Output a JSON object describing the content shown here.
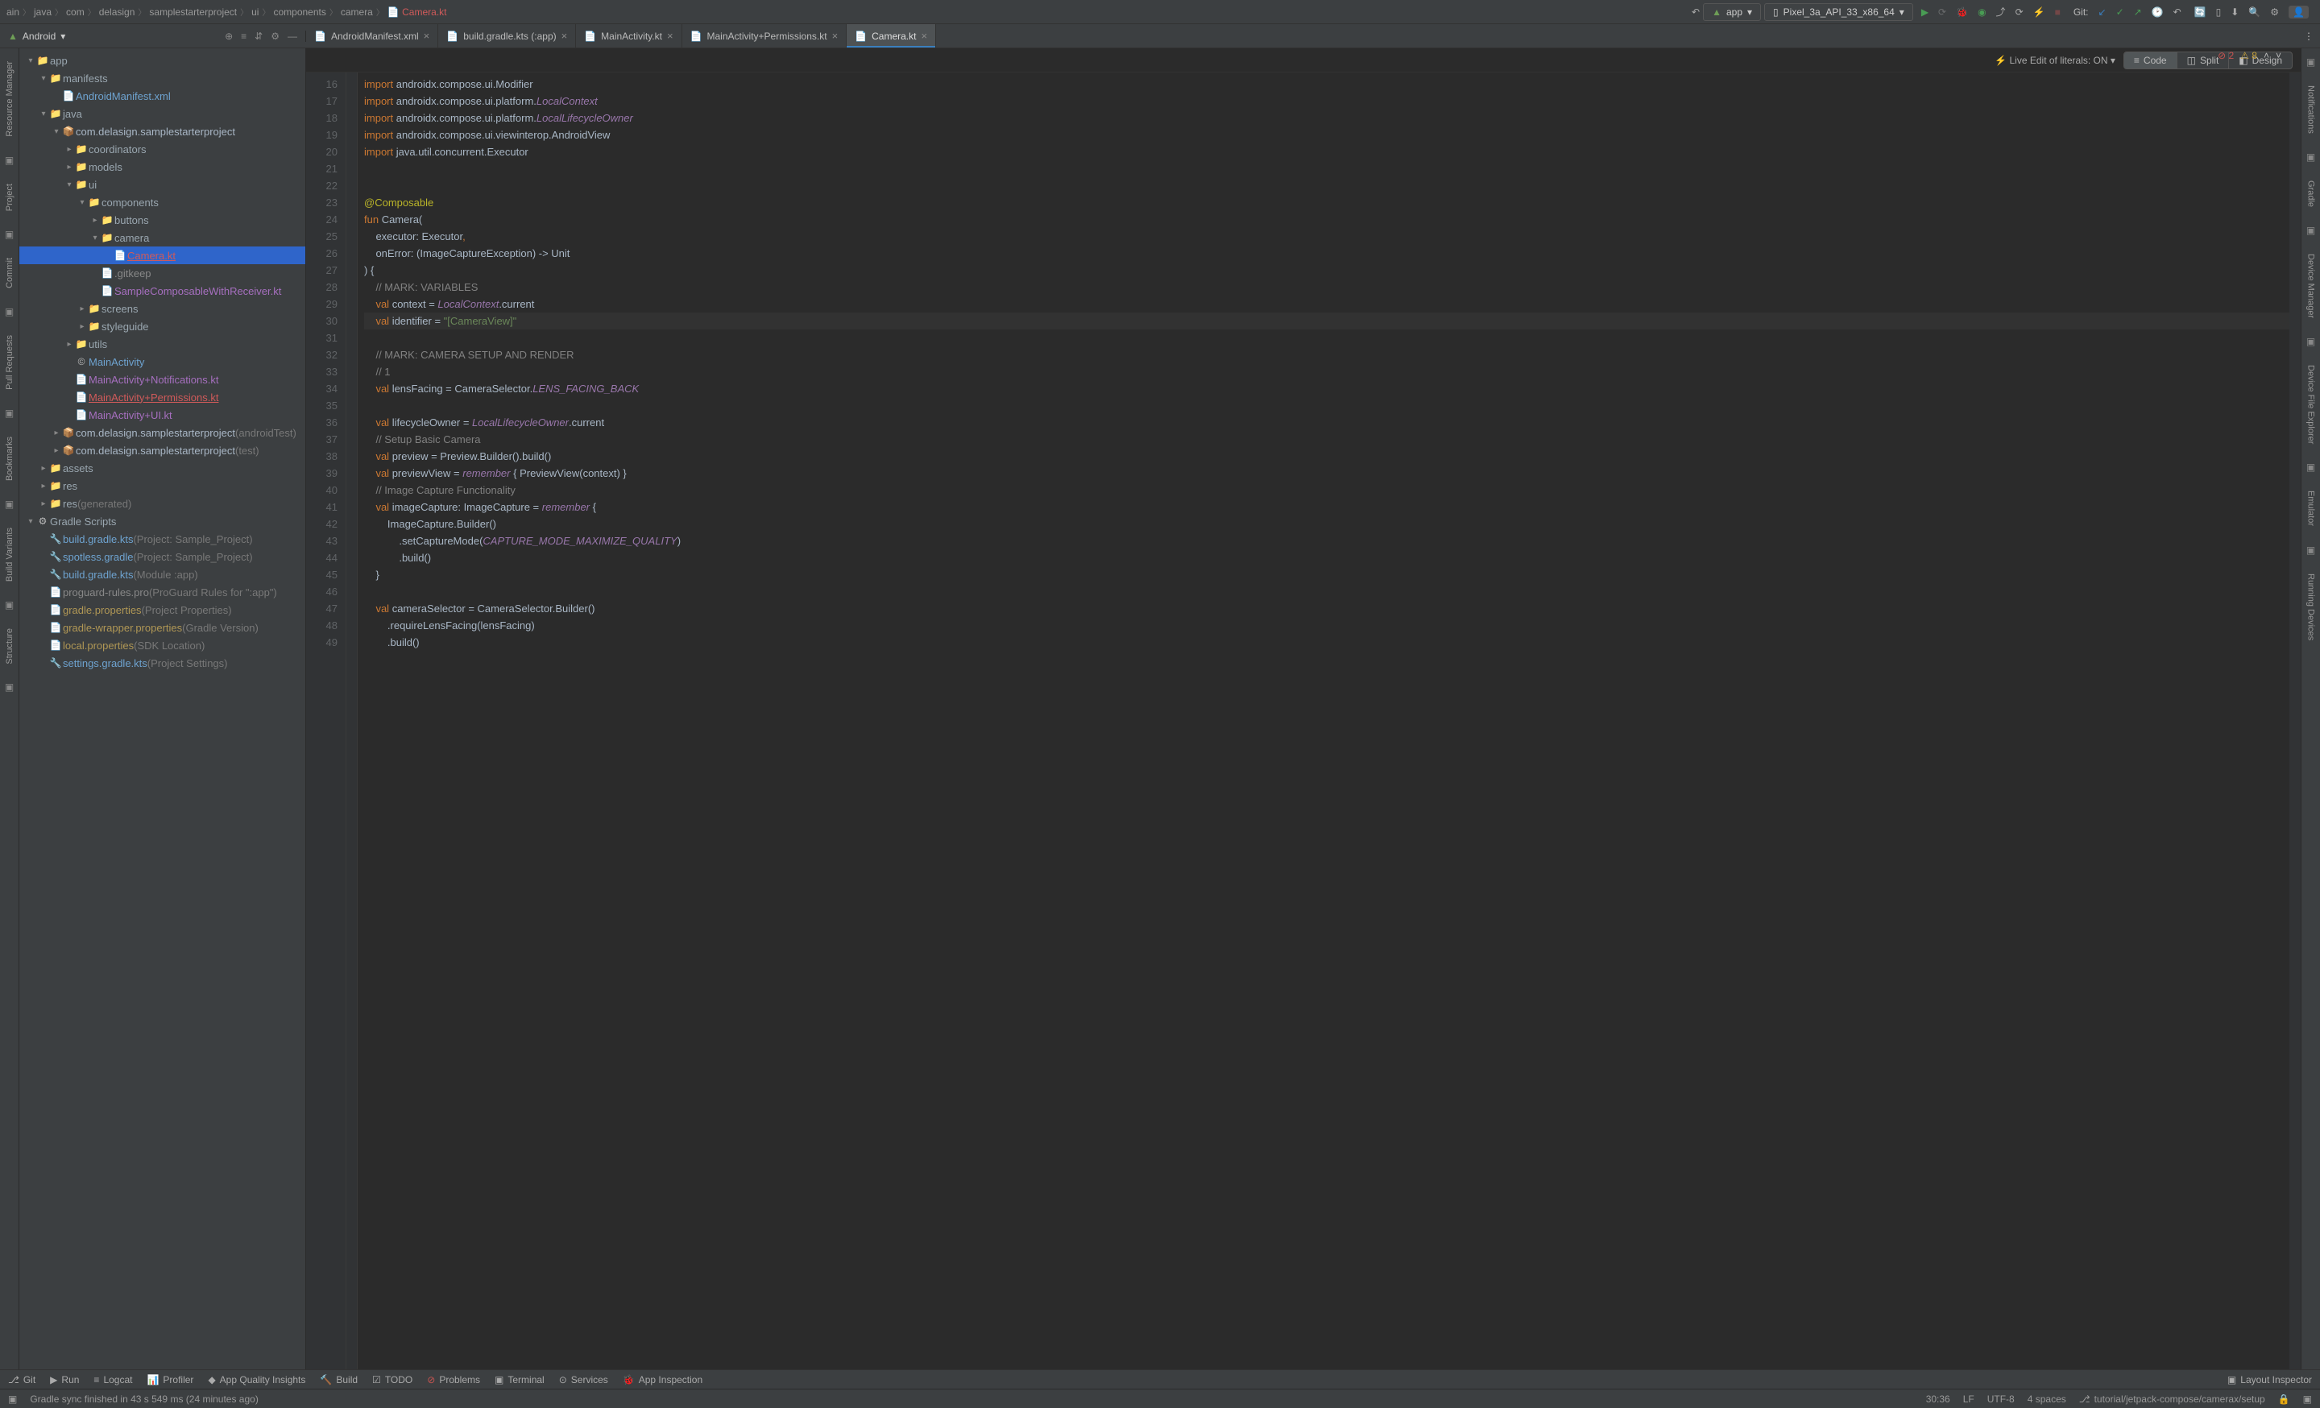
{
  "breadcrumb": [
    "ain",
    "java",
    "com",
    "delasign",
    "samplestarterproject",
    "ui",
    "components",
    "camera"
  ],
  "breadcrumb_file": "Camera.kt",
  "run_configs": {
    "app": "app",
    "device": "Pixel_3a_API_33_x86_64"
  },
  "git_label": "Git:",
  "project_selector": "Android",
  "tabs": [
    {
      "label": "AndroidManifest.xml",
      "cls": "tab-gradle"
    },
    {
      "label": "build.gradle.kts (:app)",
      "cls": "tab-gradle"
    },
    {
      "label": "MainActivity.kt",
      "cls": "tab-kotlin"
    },
    {
      "label": "MainActivity+Permissions.kt",
      "cls": "tab-red"
    },
    {
      "label": "Camera.kt",
      "cls": "tab-red",
      "active": true
    }
  ],
  "live_edit": "Live Edit of literals: ON",
  "view_modes": {
    "code": "Code",
    "split": "Split",
    "design": "Design"
  },
  "errors": {
    "err": "2",
    "warn": "8"
  },
  "tree": [
    {
      "d": 0,
      "ar": "▾",
      "ic": "📁",
      "txt": "app",
      "cls": "dir",
      "b": true
    },
    {
      "d": 1,
      "ar": "▾",
      "ic": "📁",
      "txt": "manifests",
      "cls": "dir"
    },
    {
      "d": 2,
      "ar": "",
      "ic": "📄",
      "txt": "AndroidManifest.xml",
      "cls": "grad"
    },
    {
      "d": 1,
      "ar": "▾",
      "ic": "📁",
      "txt": "java",
      "cls": "dir"
    },
    {
      "d": 2,
      "ar": "▾",
      "ic": "📦",
      "txt": "com.delasign.samplestarterproject",
      "cls": "pkg"
    },
    {
      "d": 3,
      "ar": "▸",
      "ic": "📁",
      "txt": "coordinators",
      "cls": "dir"
    },
    {
      "d": 3,
      "ar": "▸",
      "ic": "📁",
      "txt": "models",
      "cls": "dir"
    },
    {
      "d": 3,
      "ar": "▾",
      "ic": "📁",
      "txt": "ui",
      "cls": "dir"
    },
    {
      "d": 4,
      "ar": "▾",
      "ic": "📁",
      "txt": "components",
      "cls": "dir"
    },
    {
      "d": 5,
      "ar": "▸",
      "ic": "📁",
      "txt": "buttons",
      "cls": "dir"
    },
    {
      "d": 5,
      "ar": "▾",
      "ic": "📁",
      "txt": "camera",
      "cls": "dir"
    },
    {
      "d": 6,
      "ar": "",
      "ic": "📄",
      "txt": "Camera.kt",
      "cls": "mod",
      "sel": true
    },
    {
      "d": 5,
      "ar": "",
      "ic": "📄",
      "txt": ".gitkeep",
      "cls": "proGray"
    },
    {
      "d": 5,
      "ar": "",
      "ic": "📄",
      "txt": "SampleComposableWithReceiver.kt",
      "cls": "ktf"
    },
    {
      "d": 4,
      "ar": "▸",
      "ic": "📁",
      "txt": "screens",
      "cls": "dir"
    },
    {
      "d": 4,
      "ar": "▸",
      "ic": "📁",
      "txt": "styleguide",
      "cls": "dir"
    },
    {
      "d": 3,
      "ar": "▸",
      "ic": "📁",
      "txt": "utils",
      "cls": "dir"
    },
    {
      "d": 3,
      "ar": "",
      "ic": "©",
      "txt": "MainActivity",
      "cls": "grad"
    },
    {
      "d": 3,
      "ar": "",
      "ic": "📄",
      "txt": "MainActivity+Notifications.kt",
      "cls": "ktf"
    },
    {
      "d": 3,
      "ar": "",
      "ic": "📄",
      "txt": "MainActivity+Permissions.kt",
      "cls": "mod"
    },
    {
      "d": 3,
      "ar": "",
      "ic": "📄",
      "txt": "MainActivity+UI.kt",
      "cls": "ktf"
    },
    {
      "d": 2,
      "ar": "▸",
      "ic": "📦",
      "txt": "com.delasign.samplestarterproject",
      "suf": "(androidTest)",
      "cls": "pkg"
    },
    {
      "d": 2,
      "ar": "▸",
      "ic": "📦",
      "txt": "com.delasign.samplestarterproject",
      "suf": "(test)",
      "cls": "pkg"
    },
    {
      "d": 1,
      "ar": "▸",
      "ic": "📁",
      "txt": "assets",
      "cls": "dir"
    },
    {
      "d": 1,
      "ar": "▸",
      "ic": "📁",
      "txt": "res",
      "cls": "dir"
    },
    {
      "d": 1,
      "ar": "▸",
      "ic": "📁",
      "txt": "res",
      "suf": "(generated)",
      "cls": "dir"
    },
    {
      "d": 0,
      "ar": "▾",
      "ic": "⚙",
      "txt": "Gradle Scripts",
      "cls": "dir"
    },
    {
      "d": 1,
      "ar": "",
      "ic": "🔧",
      "txt": "build.gradle.kts",
      "suf": "(Project: Sample_Project)",
      "cls": "grad"
    },
    {
      "d": 1,
      "ar": "",
      "ic": "🔧",
      "txt": "spotless.gradle",
      "suf": "(Project: Sample_Project)",
      "cls": "grad"
    },
    {
      "d": 1,
      "ar": "",
      "ic": "🔧",
      "txt": "build.gradle.kts",
      "suf": "(Module :app)",
      "cls": "grad"
    },
    {
      "d": 1,
      "ar": "",
      "ic": "📄",
      "txt": "proguard-rules.pro",
      "suf": "(ProGuard Rules for \":app\")",
      "cls": "proGray"
    },
    {
      "d": 1,
      "ar": "",
      "ic": "📄",
      "txt": "gradle.properties",
      "suf": "(Project Properties)",
      "cls": "prop"
    },
    {
      "d": 1,
      "ar": "",
      "ic": "📄",
      "txt": "gradle-wrapper.properties",
      "suf": "(Gradle Version)",
      "cls": "prop"
    },
    {
      "d": 1,
      "ar": "",
      "ic": "📄",
      "txt": "local.properties",
      "suf": "(SDK Location)",
      "cls": "local"
    },
    {
      "d": 1,
      "ar": "",
      "ic": "🔧",
      "txt": "settings.gradle.kts",
      "suf": "(Project Settings)",
      "cls": "grad"
    }
  ],
  "code": {
    "start": 16,
    "cur": 30,
    "lines": [
      [
        [
          "kw",
          "import"
        ],
        [
          "",
          " androidx.compose.ui.Modifier"
        ]
      ],
      [
        [
          "kw",
          "import"
        ],
        [
          "",
          " androidx.compose.ui.platform."
        ],
        [
          "ital",
          "LocalContext"
        ]
      ],
      [
        [
          "kw",
          "import"
        ],
        [
          "",
          " androidx.compose.ui.platform."
        ],
        [
          "ital",
          "LocalLifecycleOwner"
        ]
      ],
      [
        [
          "kw",
          "import"
        ],
        [
          "",
          " androidx.compose.ui.viewinterop.AndroidView"
        ]
      ],
      [
        [
          "kw",
          "import"
        ],
        [
          "",
          " java.util.concurrent.Executor"
        ]
      ],
      [],
      [],
      [
        [
          "ann",
          "@Composable"
        ]
      ],
      [
        [
          "kw",
          "fun"
        ],
        [
          "",
          " Camera("
        ]
      ],
      [
        [
          "",
          "    executor: Executor"
        ],
        [
          "kw",
          ","
        ]
      ],
      [
        [
          "",
          "    onError: (ImageCaptureException) -> Unit"
        ]
      ],
      [
        [
          "",
          ") {"
        ]
      ],
      [
        [
          "",
          "    "
        ],
        [
          "cmt",
          "// MARK: VARIABLES"
        ]
      ],
      [
        [
          "",
          "    "
        ],
        [
          "kw",
          "val"
        ],
        [
          "",
          " context = "
        ],
        [
          "ital",
          "LocalContext"
        ],
        [
          "",
          ".current"
        ]
      ],
      [
        [
          "",
          "    "
        ],
        [
          "kw",
          "val"
        ],
        [
          "",
          " identifier = "
        ],
        [
          "str",
          "\"[CameraView]\""
        ]
      ],
      [],
      [
        [
          "",
          "    "
        ],
        [
          "cmt",
          "// MARK: CAMERA SETUP AND RENDER"
        ]
      ],
      [
        [
          "",
          "    "
        ],
        [
          "cmt",
          "// 1"
        ]
      ],
      [
        [
          "",
          "    "
        ],
        [
          "kw",
          "val"
        ],
        [
          "",
          " lensFacing = CameraSelector."
        ],
        [
          "cst",
          "LENS_FACING_BACK"
        ]
      ],
      [],
      [
        [
          "",
          "    "
        ],
        [
          "kw",
          "val"
        ],
        [
          "",
          " lifecycleOwner = "
        ],
        [
          "ital",
          "LocalLifecycleOwner"
        ],
        [
          "",
          ".current"
        ]
      ],
      [
        [
          "",
          "    "
        ],
        [
          "cmt",
          "// Setup Basic Camera"
        ]
      ],
      [
        [
          "",
          "    "
        ],
        [
          "kw",
          "val"
        ],
        [
          "",
          " preview = Preview.Builder().build()"
        ]
      ],
      [
        [
          "",
          "    "
        ],
        [
          "kw",
          "val"
        ],
        [
          "",
          " previewView = "
        ],
        [
          "ital",
          "remember"
        ],
        [
          "",
          " { PreviewView(context) }"
        ]
      ],
      [
        [
          "",
          "    "
        ],
        [
          "cmt",
          "// Image Capture Functionality"
        ]
      ],
      [
        [
          "",
          "    "
        ],
        [
          "kw",
          "val"
        ],
        [
          "",
          " imageCapture: ImageCapture = "
        ],
        [
          "ital",
          "remember"
        ],
        [
          "",
          " {"
        ]
      ],
      [
        [
          "",
          "        ImageCapture.Builder()"
        ]
      ],
      [
        [
          "",
          "            .setCaptureMode("
        ],
        [
          "cst",
          "CAPTURE_MODE_MAXIMIZE_QUALITY"
        ],
        [
          "",
          ")"
        ]
      ],
      [
        [
          "",
          "            .build()"
        ]
      ],
      [
        [
          "",
          "    }"
        ]
      ],
      [],
      [
        [
          "",
          "    "
        ],
        [
          "kw",
          "val"
        ],
        [
          "",
          " cameraSelector = CameraSelector.Builder()"
        ]
      ],
      [
        [
          "",
          "        .requireLensFacing(lensFacing)"
        ]
      ],
      [
        [
          "",
          "        .build()"
        ]
      ]
    ]
  },
  "left_tools": [
    "Resource Manager",
    "Project",
    "Commit",
    "Pull Requests",
    "Bookmarks",
    "Build Variants",
    "Structure"
  ],
  "right_tools": [
    "Notifications",
    "Gradle",
    "Device Manager",
    "Device File Explorer",
    "Emulator",
    "Running Devices"
  ],
  "bottom": [
    {
      "ic": "⎇",
      "t": "Git"
    },
    {
      "ic": "▶",
      "t": "Run"
    },
    {
      "ic": "≡",
      "t": "Logcat"
    },
    {
      "ic": "📊",
      "t": "Profiler"
    },
    {
      "ic": "◆",
      "t": "App Quality Insights"
    },
    {
      "ic": "🔨",
      "t": "Build"
    },
    {
      "ic": "☑",
      "t": "TODO"
    },
    {
      "ic": "⊘",
      "t": "Problems",
      "c": "#c75450"
    },
    {
      "ic": "▣",
      "t": "Terminal"
    },
    {
      "ic": "⊙",
      "t": "Services"
    },
    {
      "ic": "🐞",
      "t": "App Inspection"
    }
  ],
  "bottom_right": "Layout Inspector",
  "status": {
    "msg": "Gradle sync finished in 43 s 549 ms (24 minutes ago)",
    "pos": "30:36",
    "le": "LF",
    "enc": "UTF-8",
    "indent": "4 spaces",
    "tut": "tutorial/jetpack-compose/camerax/setup"
  }
}
